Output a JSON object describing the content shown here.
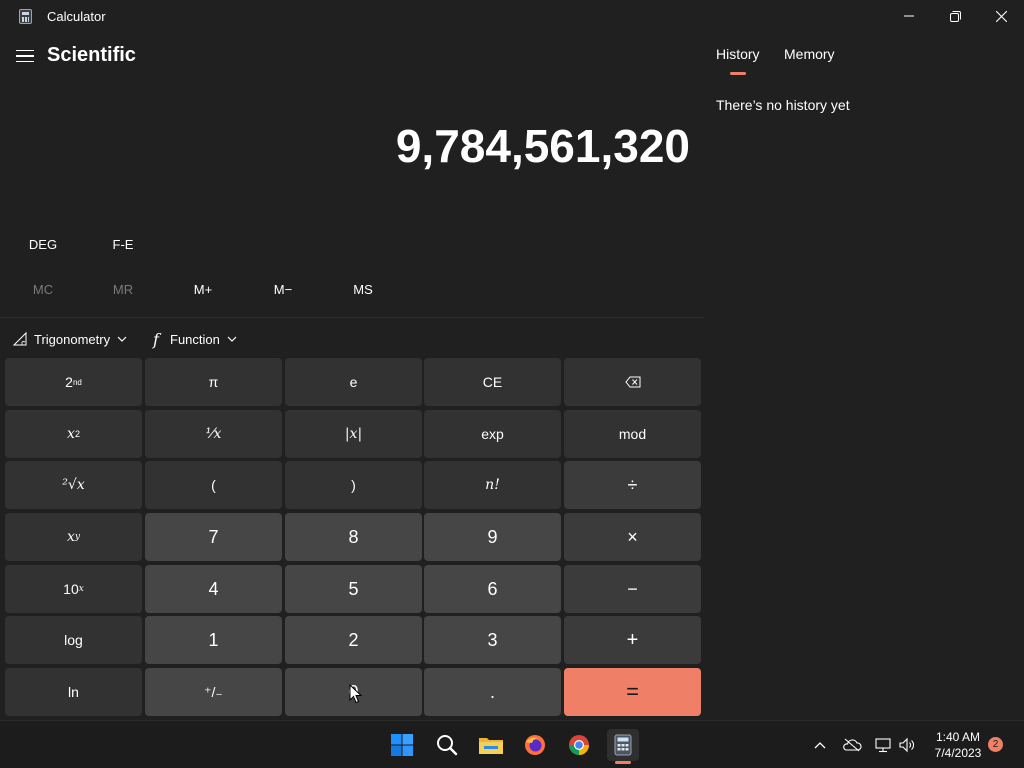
{
  "window": {
    "title": "Calculator",
    "icon": "calculator-icon"
  },
  "header": {
    "menu_icon": "hamburger-icon",
    "mode": "Scientific"
  },
  "display": {
    "value": "9,784,561,320"
  },
  "mode_row": {
    "angle": "DEG",
    "fe": "F-E"
  },
  "memory": {
    "mc": "MC",
    "mr": "MR",
    "m_plus": "M+",
    "m_minus": "M−",
    "ms": "MS"
  },
  "dropdowns": {
    "trig": "Trigonometry",
    "func": "Function"
  },
  "keys": {
    "second": "2",
    "second_sup": "nd",
    "pi": "π",
    "e": "e",
    "ce": "CE",
    "square_base": "x",
    "square_exp": "2",
    "reciprocal": "⅟x",
    "abs": "|x|",
    "exp": "exp",
    "mod": "mod",
    "sqrt": "²√x",
    "lparen": "(",
    "rparen": ")",
    "factorial": "n!",
    "divide": "÷",
    "power_base": "x",
    "power_exp": "y",
    "seven": "7",
    "eight": "8",
    "nine": "9",
    "multiply": "×",
    "ten_base": "10",
    "ten_exp": "x",
    "four": "4",
    "five": "5",
    "six": "6",
    "minus": "−",
    "log": "log",
    "one": "1",
    "two": "2",
    "three": "3",
    "plus": "+",
    "ln": "ln",
    "negate": "⁺/₋",
    "zero": "0",
    "decimal": ".",
    "equals": "="
  },
  "history_panel": {
    "tab_history": "History",
    "tab_memory": "Memory",
    "empty_text": "There’s no history yet"
  },
  "taskbar": {
    "time": "1:40 AM",
    "date": "7/4/2023",
    "notifications": "2"
  },
  "colors": {
    "accent": "#ef8067",
    "background": "#202020",
    "key_number": "#464646",
    "key_function": "#3b3b3b"
  }
}
